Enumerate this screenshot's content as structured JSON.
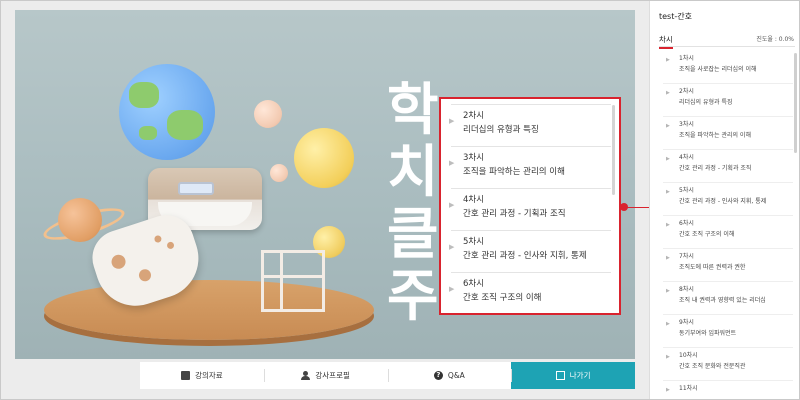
{
  "sidebar": {
    "title": "test-간호",
    "tab_label": "차시",
    "progress_text": "진도율 : 0.0%",
    "items": [
      {
        "num": "1차시",
        "desc": "조직을 사로잡는 리더십의 이해"
      },
      {
        "num": "2차시",
        "desc": "리더십의 유형과 특징"
      },
      {
        "num": "3차시",
        "desc": "조직을 파악하는 관리의 이해"
      },
      {
        "num": "4차시",
        "desc": "간호 관리 과정 - 기획과 조직"
      },
      {
        "num": "5차시",
        "desc": "간호 관리 과정 - 인사와 지휘, 통제"
      },
      {
        "num": "6차시",
        "desc": "간호 조직 구조의 이해"
      },
      {
        "num": "7차시",
        "desc": "조직도에 따른 권력과 권한"
      },
      {
        "num": "8차시",
        "desc": "조직 내 권력과 영향력 있는 리더십"
      },
      {
        "num": "9차시",
        "desc": "동기부여와 임파워먼트"
      },
      {
        "num": "10차시",
        "desc": "간호 조직 문화와 전문직관"
      },
      {
        "num": "11차시",
        "desc": ""
      }
    ]
  },
  "popup": {
    "items": [
      {
        "num": "2차시",
        "desc": "리더십의 유형과 특징"
      },
      {
        "num": "3차시",
        "desc": "조직을 파악하는 관리의 이해"
      },
      {
        "num": "4차시",
        "desc": "간호 관리 과정 - 기획과 조직"
      },
      {
        "num": "5차시",
        "desc": "간호 관리 과정 - 인사와 지휘, 통제"
      },
      {
        "num": "6차시",
        "desc": "간호 조직 구조의 이해"
      }
    ]
  },
  "stage": {
    "bg_text_lines": [
      "학",
      "치",
      "클",
      "주"
    ]
  },
  "toolbar": {
    "materials_label": "강의자료",
    "profile_label": "강사프로필",
    "qa_label": "Q&A",
    "exit_label": "나가기"
  },
  "icons": {
    "materials": "folder-icon",
    "profile": "user-icon",
    "qa": "question-icon",
    "exit": "door-icon"
  },
  "colors": {
    "accent_red": "#d9232e",
    "exit_teal": "#1ea3b4"
  }
}
